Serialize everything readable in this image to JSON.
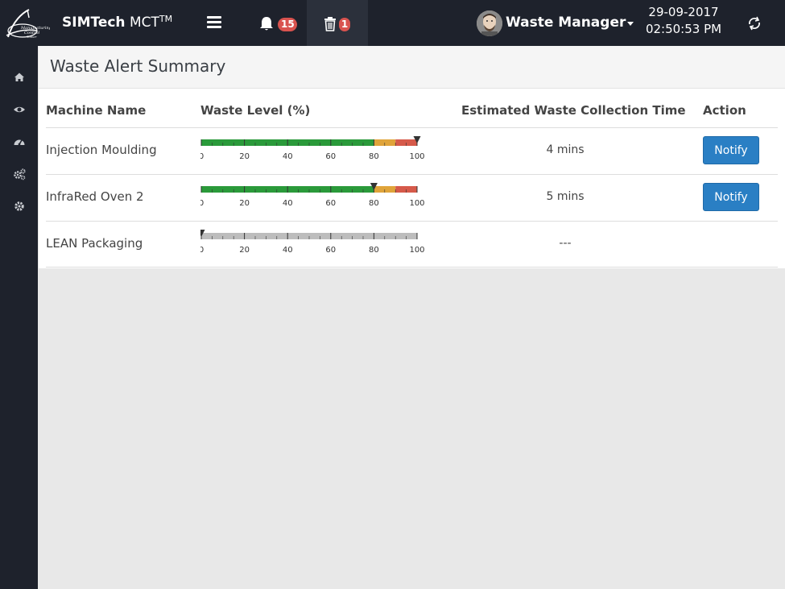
{
  "topbar": {
    "brand_name": "SIMTech",
    "brand_suffix": "MCT",
    "brand_sup": "TM",
    "notification_count": "15",
    "waste_count": "1",
    "user_name": "Waste Manager",
    "date": "29-09-2017",
    "time": "02:50:53 PM"
  },
  "sidebar": {
    "items": [
      {
        "icon": "home-icon"
      },
      {
        "icon": "eye-icon"
      },
      {
        "icon": "dashboard-gauge-icon"
      },
      {
        "icon": "cogs-icon"
      },
      {
        "icon": "gear-icon"
      }
    ]
  },
  "page": {
    "title": "Waste Alert Summary"
  },
  "table": {
    "headers": {
      "machine": "Machine Name",
      "waste": "Waste Level (%)",
      "eta": "Estimated Waste Collection Time",
      "action": "Action"
    },
    "rows": [
      {
        "machine": "Injection Moulding",
        "waste_level": 100,
        "eta": "4 mins",
        "action": "Notify",
        "active": true
      },
      {
        "machine": "InfraRed Oven 2",
        "waste_level": 80,
        "eta": "5 mins",
        "action": "Notify",
        "active": true
      },
      {
        "machine": "LEAN Packaging",
        "waste_level": 0,
        "eta": "---",
        "action": "",
        "active": false
      }
    ],
    "gauge_ticks": [
      "0",
      "20",
      "40",
      "60",
      "80",
      "100"
    ],
    "gauge_bands": [
      {
        "from": 0,
        "to": 80,
        "color": "#2a9a3a"
      },
      {
        "from": 80,
        "to": 90,
        "color": "#e0a43a"
      },
      {
        "from": 90,
        "to": 100,
        "color": "#d65a4a"
      }
    ],
    "inactive_color": "#bdbdbd"
  }
}
